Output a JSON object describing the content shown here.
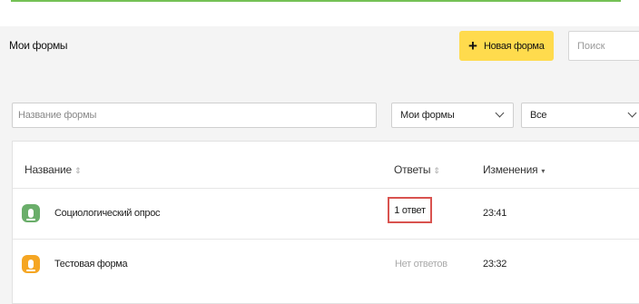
{
  "header": {
    "title": "Мои формы",
    "new_form_label": "Новая форма",
    "search_placeholder": "Поиск"
  },
  "filters": {
    "name_placeholder": "Название формы",
    "owner_value": "Мои формы",
    "status_value": "Все"
  },
  "table": {
    "columns": {
      "name": "Название",
      "answers": "Ответы",
      "changes": "Изменения"
    },
    "rows": [
      {
        "name": "Социологический опрос",
        "answers": "1 ответ",
        "changed": "23:41",
        "icon_color": "#6aae6a"
      },
      {
        "name": "Тестовая форма",
        "answers": "Нет ответов",
        "changed": "23:32",
        "icon_color": "#f5a623"
      }
    ]
  },
  "colors": {
    "accent_line": "#74c155",
    "primary_button": "#ffdb4d",
    "highlight_border": "#d9534f"
  }
}
